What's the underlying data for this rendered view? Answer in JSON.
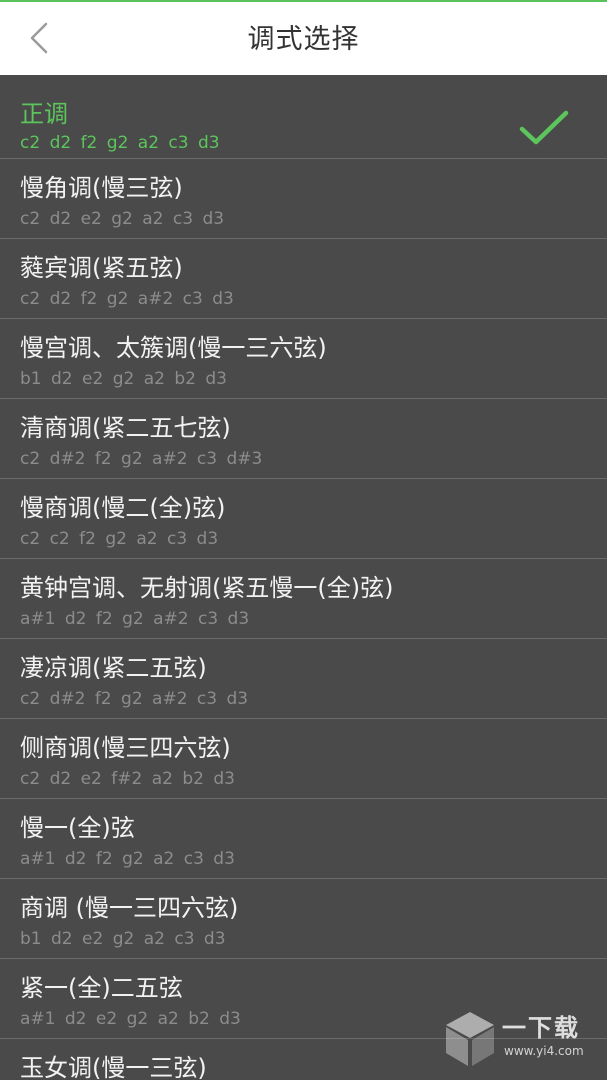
{
  "header": {
    "title": "调式选择",
    "back_icon": "chevron-left-icon"
  },
  "colors": {
    "accent": "#5cc55c",
    "background": "#4a4a4a",
    "header_bg": "#ffffff",
    "title_text": "#333333",
    "item_text": "#f2f2f2",
    "notes_text": "#8c8c8c",
    "divider": "#6a6a6a"
  },
  "modes": [
    {
      "name": "正调",
      "notes": "c2 d2 f2 g2 a2 c3 d3",
      "selected": true
    },
    {
      "name": "慢角调(慢三弦)",
      "notes": "c2 d2 e2 g2 a2 c3 d3",
      "selected": false
    },
    {
      "name": "蕤宾调(紧五弦)",
      "notes": "c2 d2 f2 g2 a#2 c3 d3",
      "selected": false
    },
    {
      "name": "慢宫调、太簇调(慢一三六弦)",
      "notes": "b1 d2 e2 g2 a2 b2 d3",
      "selected": false
    },
    {
      "name": "清商调(紧二五七弦)",
      "notes": "c2 d#2 f2 g2 a#2 c3 d#3",
      "selected": false
    },
    {
      "name": "慢商调(慢二(全)弦)",
      "notes": "c2 c2 f2 g2 a2 c3 d3",
      "selected": false
    },
    {
      "name": "黄钟宫调、无射调(紧五慢一(全)弦)",
      "notes": "a#1 d2 f2 g2 a#2 c3 d3",
      "selected": false
    },
    {
      "name": "凄凉调(紧二五弦)",
      "notes": "c2 d#2 f2 g2 a#2 c3 d3",
      "selected": false
    },
    {
      "name": "侧商调(慢三四六弦)",
      "notes": "c2 d2 e2 f#2 a2 b2 d3",
      "selected": false
    },
    {
      "name": "慢一(全)弦",
      "notes": "a#1 d2 f2 g2 a2 c3 d3",
      "selected": false
    },
    {
      "name": "商调 (慢一三四六弦)",
      "notes": "b1 d2 e2 g2 a2 c3 d3",
      "selected": false
    },
    {
      "name": "紧一(全)二五弦",
      "notes": "a#1 d2 e2 g2 a2 b2 d3",
      "selected": false
    },
    {
      "name": "玉女调(慢一三弦)",
      "notes": "",
      "selected": false
    }
  ],
  "watermark": {
    "text": "一下载",
    "url": "www.yi4.com",
    "icon": "cube-logo-icon"
  }
}
